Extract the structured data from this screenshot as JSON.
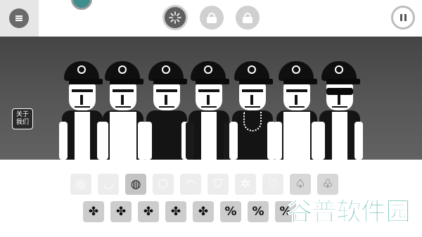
{
  "topbar": {
    "menu_icon": "menu-icon",
    "mode_buttons": [
      {
        "icon": "sparkle-icon",
        "state": "active"
      },
      {
        "icon": "lock-icon",
        "state": "locked"
      },
      {
        "icon": "lock-icon",
        "state": "locked"
      }
    ],
    "pause_icon": "pause-icon"
  },
  "stage": {
    "about_button": {
      "line1": "关于",
      "line2": "我们"
    },
    "characters": [
      {
        "id": 1,
        "hat_logo": "smile"
      },
      {
        "id": 2,
        "hat_logo": "swirl"
      },
      {
        "id": 3,
        "hat_logo": "shield"
      },
      {
        "id": 4,
        "hat_logo": "arch"
      },
      {
        "id": 5,
        "hat_logo": "scroll"
      },
      {
        "id": 6,
        "hat_logo": "burst"
      },
      {
        "id": 7,
        "hat_logo": "heart"
      }
    ]
  },
  "sound_row_1": [
    {
      "glyph": "◎",
      "state": "faded"
    },
    {
      "glyph": "◡",
      "state": "faded"
    },
    {
      "glyph": "◍",
      "state": "selected"
    },
    {
      "glyph": "⬡",
      "state": "faded"
    },
    {
      "glyph": "◠",
      "state": "faded"
    },
    {
      "glyph": "⛉",
      "state": "faded"
    },
    {
      "glyph": "✲",
      "state": "faded"
    },
    {
      "glyph": "♡",
      "state": "faded"
    },
    {
      "glyph": "♤",
      "state": "dim"
    },
    {
      "glyph": "♧",
      "state": "dim"
    }
  ],
  "sound_row_2": [
    {
      "glyph": "✤"
    },
    {
      "glyph": "✤"
    },
    {
      "glyph": "✤"
    },
    {
      "glyph": "✤"
    },
    {
      "glyph": "✤"
    },
    {
      "glyph": "%"
    },
    {
      "glyph": "%"
    },
    {
      "glyph": "%"
    }
  ],
  "watermark": {
    "text": "谷普软件园"
  },
  "colors": {
    "stage_dark": "#454545",
    "tile_light": "#e9e9e9",
    "tile_dark": "#cdcdcd",
    "watermark": "#2aa398"
  }
}
